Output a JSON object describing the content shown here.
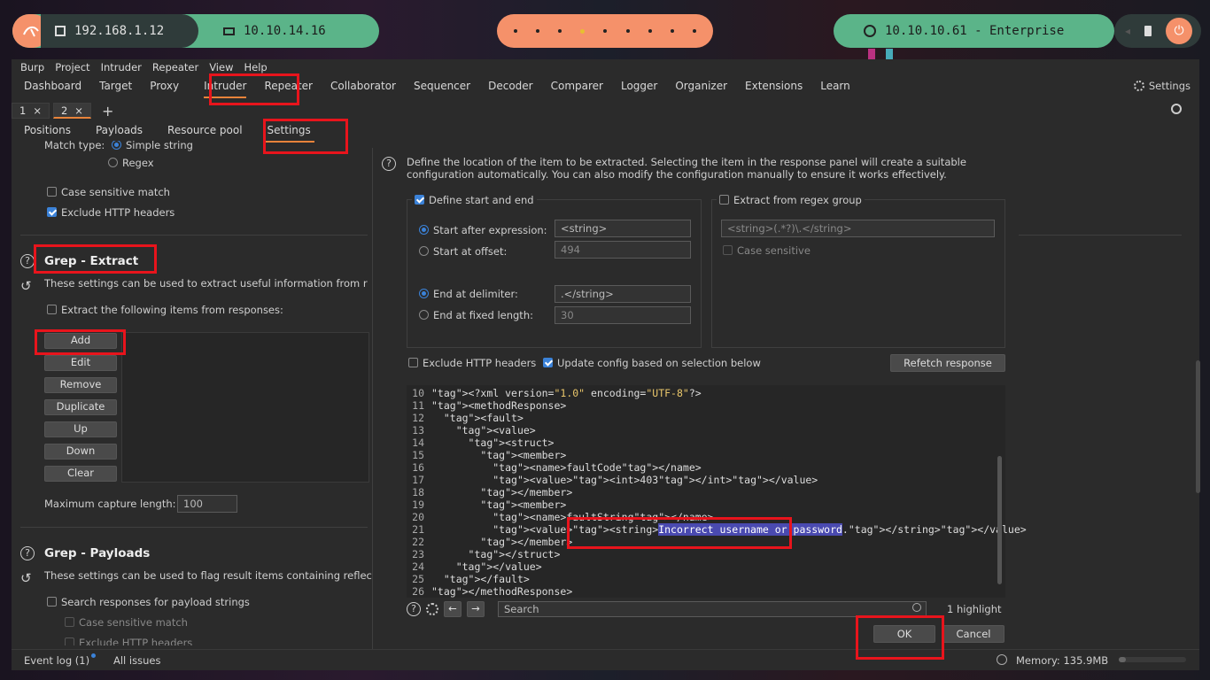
{
  "taskbar": {
    "ip_local": "192.168.1.12",
    "ip_vpn": "10.10.14.16",
    "target": "10.10.10.61 - Enterprise"
  },
  "menu": [
    "Burp",
    "Project",
    "Intruder",
    "Repeater",
    "View",
    "Help"
  ],
  "main_tabs": [
    "Dashboard",
    "Target",
    "Proxy",
    "Intruder",
    "Repeater",
    "Collaborator",
    "Sequencer",
    "Decoder",
    "Comparer",
    "Logger",
    "Organizer",
    "Extensions",
    "Learn"
  ],
  "settings_label": "Settings",
  "attack_tabs": [
    {
      "label": "1"
    },
    {
      "label": "2"
    }
  ],
  "add_tab": "+",
  "sub_tabs": [
    "Positions",
    "Payloads",
    "Resource pool",
    "Settings"
  ],
  "left": {
    "match_type_label": "Match type:",
    "simple_string": "Simple string",
    "regex": "Regex",
    "case_sensitive": "Case sensitive match",
    "exclude_headers": "Exclude HTTP headers",
    "grep_extract_title": "Grep - Extract",
    "grep_extract_desc": "These settings can be used to extract useful information from r",
    "extract_items": "Extract the following items from responses:",
    "buttons": [
      "Add",
      "Edit",
      "Remove",
      "Duplicate",
      "Up",
      "Down",
      "Clear"
    ],
    "max_capture_label": "Maximum capture length:",
    "max_capture_value": "100",
    "grep_payloads_title": "Grep - Payloads",
    "grep_payloads_desc": "These settings can be used to flag result items containing reflec",
    "search_payloads": "Search responses for payload strings",
    "case_sensitive_match": "Case sensitive match",
    "exclude_http_headers": "Exclude HTTP headers"
  },
  "dialog": {
    "desc_line1": "Define the location of the item to be extracted. Selecting the item in the response panel will create a suitable",
    "desc_line2": "configuration automatically. You can also modify the configuration manually to ensure it works effectively.",
    "define_start_end": "Define start and end",
    "start_after_expr": "Start after expression:",
    "start_after_value": "<string>",
    "start_at_offset": "Start at offset:",
    "start_offset_value": "494",
    "end_at_delim": "End at delimiter:",
    "end_delim_value": ".</string>",
    "end_fixed_len": "End at fixed length:",
    "end_fixed_value": "30",
    "extract_regex": "Extract from regex group",
    "regex_value": "<string>(.*?)\\.</string>",
    "regex_case": "Case sensitive",
    "exclude_headers": "Exclude HTTP headers",
    "update_config": "Update config based on selection below",
    "refetch": "Refetch response",
    "search_placeholder": "Search",
    "highlights": "1 highlight",
    "ok": "OK",
    "cancel": "Cancel"
  },
  "code_lines": [
    {
      "n": "10",
      "t": "<?xml version=\"1.0\" encoding=\"UTF-8\"?>"
    },
    {
      "n": "11",
      "t": "<methodResponse>"
    },
    {
      "n": "12",
      "t": "  <fault>"
    },
    {
      "n": "13",
      "t": "    <value>"
    },
    {
      "n": "14",
      "t": "      <struct>"
    },
    {
      "n": "15",
      "t": "        <member>"
    },
    {
      "n": "16",
      "t": "          <name>faultCode</name>"
    },
    {
      "n": "17",
      "t": "          <value><int>403</int></value>"
    },
    {
      "n": "18",
      "t": "        </member>"
    },
    {
      "n": "19",
      "t": "        <member>"
    },
    {
      "n": "20",
      "t": "          <name>faultString</name>"
    },
    {
      "n": "21",
      "t": "          <value><string>Incorrect username or password.</string></value>"
    },
    {
      "n": "22",
      "t": "        </member>"
    },
    {
      "n": "23",
      "t": "      </struct>"
    },
    {
      "n": "24",
      "t": "    </value>"
    },
    {
      "n": "25",
      "t": "  </fault>"
    },
    {
      "n": "26",
      "t": "</methodResponse>"
    }
  ],
  "highlight_text": "Incorrect username or password",
  "status": {
    "event_log": "Event log (1)",
    "all_issues": "All issues",
    "memory": "Memory: 135.9MB"
  },
  "colors": {
    "accent": "#e8833a",
    "highlight": "#e8141c",
    "pill_green": "#5bb489",
    "pill_salmon": "#f5916a"
  }
}
